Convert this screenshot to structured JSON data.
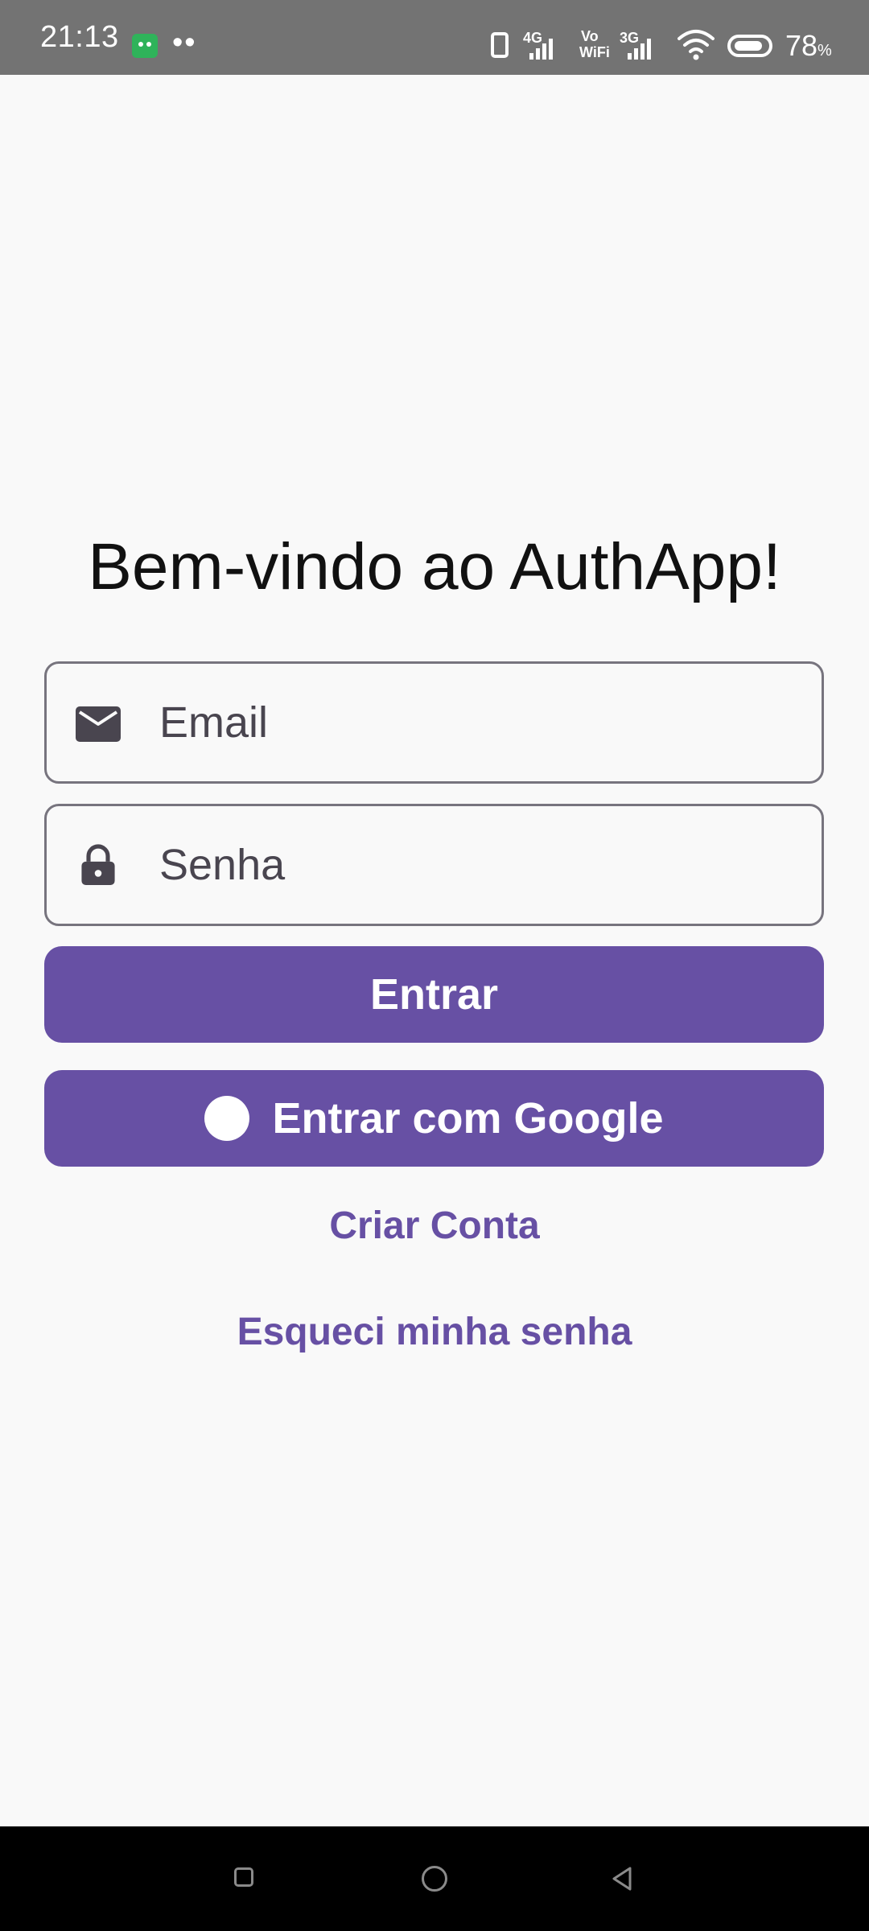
{
  "status_bar": {
    "time": "21:13",
    "dots": "••",
    "net_1": "4G",
    "net_2_top": "Vo",
    "net_2_bottom": "WiFi",
    "net_3": "3G",
    "battery_percent": "78",
    "battery_unit": "%",
    "battery_level": 0.78
  },
  "login": {
    "title": "Bem-vindo ao AuthApp!",
    "email_placeholder": "Email",
    "email_value": "",
    "password_placeholder": "Senha",
    "password_value": "",
    "login_button": "Entrar",
    "google_button": "Entrar com Google",
    "create_account": "Criar Conta",
    "forgot_password": "Esqueci minha senha"
  },
  "colors": {
    "primary": "#6750a4",
    "background": "#f9f9f9",
    "status_bar": "#737373",
    "outline": "#77747e",
    "icon": "#49454f"
  },
  "icons": {
    "email_field": "mail-icon",
    "password_field": "lock-icon",
    "google_button": "google-icon"
  }
}
